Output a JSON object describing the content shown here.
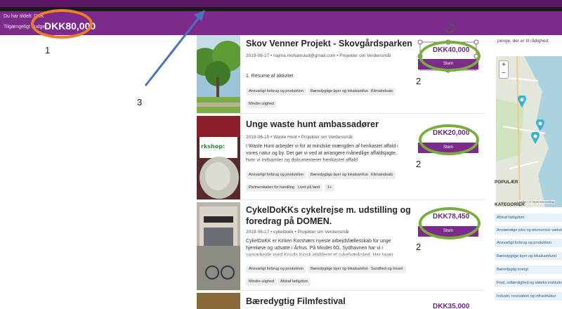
{
  "header": {
    "budget_line1": "Du har tildelt: DKK",
    "budget_line2": "Tilgængeligt budget:",
    "available_amount": "DKK80,000"
  },
  "annotations": [
    "1",
    "2",
    "2",
    "2",
    "3"
  ],
  "projects": [
    {
      "title": "Skov Venner Projekt - Skovgårdsparken",
      "meta": "2019-06-17 • najma.mohamoud@gmail.com • Projekter om Verdensmål",
      "description": "1. Resume af aktivitet",
      "tags": [
        "Ansvarligt forbrug og produktion",
        "Bæredygtige byer og lokalsamfund",
        "Klimaindsats",
        "Mindre ulighed"
      ],
      "amount": "DKK40,000",
      "vote_label": "Stem"
    },
    {
      "title": "Unge waste hunt ambassadører",
      "meta": "2019-06-15 • Waste Hunt • Projekter om Verdensmål",
      "description": "I Waste Hunt arbejder vi for at mindske mængden af henkastet affald i vores natur og by. Det gør vi ved at arrangere månedlige affaldsjagte, hvor vi indsamler og dokumenterer henkastet affald",
      "tags": [
        "Ansvarligt forbrug og produktion",
        "Bæredygtige byer og lokalsamfund",
        "Klimaindsats",
        "Partnerskaber for handling",
        "Livet på land",
        "1+"
      ],
      "amount": "DKK20,000",
      "vote_label": "Stem"
    },
    {
      "title_line1": "CykelDoKKs cykelrejse m. udstilling og",
      "title_line2": "foredrag på DOMEN.",
      "meta": "2019-06-17 • cykeldokk • Projekter om Verdensmål",
      "description": "CykelDoKK er Kirken Korshærs nyeste arbejdsfællesskab for unge hjemløse og udsatte i Århus. På Mindet 6G, Sydhavnen har vi i samarbejde med Knuds Kiosk etableret et cykelværksted. Her tager",
      "tags": [
        "Ansvarligt forbrug og produktion",
        "Bæredygtige byer og lokalsamfund",
        "Sundhed og trivsel",
        "Mindre ulighed",
        "Afskaf fattigdom"
      ],
      "amount": "DKK78,450",
      "vote_label": "Stem"
    },
    {
      "title": "Bæredygtig Filmfestival",
      "amount": "DKK35,000"
    }
  ],
  "sidebar": {
    "intro_text": "penge, der er til rådighed.",
    "map_zoom_in": "+",
    "map_zoom_out": "−",
    "map_attribution": "Leaflet | © OpenStreetMap",
    "popular_heading": "POPULÆR",
    "categories_heading": "KATEGORIER",
    "categories": [
      "Afskaf fattigdom",
      "Anstændige jobs og økonomisk vækst",
      "Ansvarligt forbrug og produktion",
      "Bæredygtige byer og lokalsamfund",
      "Bæredygtig energi",
      "Fred, retfærdighed og stærke institutioner",
      "Industri, innovation og infrastruktur"
    ]
  },
  "colors": {
    "brand_purple": "#7c2b8a",
    "highlight_orange": "#ee7d28",
    "highlight_green": "#79ad3c",
    "annotation_arrow": "#4a72c0"
  }
}
